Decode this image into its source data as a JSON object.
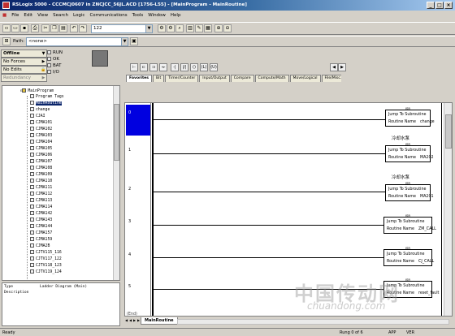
{
  "title": "RSLogix 5000 - CCCMCJ0607 in ZNCJCC_56JL.ACD [1756-L55] - [MainProgram - MainRoutine]",
  "menu": [
    "File",
    "Edit",
    "View",
    "Search",
    "Logic",
    "Communications",
    "Tools",
    "Window",
    "Help"
  ],
  "toolbar": {
    "zoom_value": "122",
    "path_label": "Path:",
    "path_value": "<none>"
  },
  "status_panel": {
    "mode": "Offline",
    "forces": "No Forces",
    "edits": "No Edits",
    "redundancy": "Redundancy",
    "lamps": [
      "RUN",
      "OK",
      "BAT",
      "I/O"
    ]
  },
  "instruction_tabs": [
    "Favorites",
    "Bit",
    "Timer/Counter",
    "Input/Output",
    "Compare",
    "Compute/Math",
    "Move/Logical",
    "File/Misc."
  ],
  "tree": {
    "root": "MainProgram",
    "items": [
      "Program Tags",
      "MainRoutine",
      "change",
      "CJAI",
      "CJMA101",
      "CJMA102",
      "CJMA103",
      "CJMA104",
      "CJMA105",
      "CJMA106",
      "CJMA107",
      "CJMA108",
      "CJMA109",
      "CJMA110",
      "CJMA111",
      "CJMA112",
      "CJMA113",
      "CJMA114",
      "CJMA142",
      "CJMA143",
      "CJMA144",
      "CJMA157",
      "CJMA159",
      "CJMA2B",
      "CJTV115_116",
      "CJTV117_122",
      "CJTV118_123",
      "CJTV119_124"
    ]
  },
  "description": {
    "type_label": "Type",
    "type_value": "Ladder Diagram (Main)",
    "desc_label": "Description"
  },
  "ladder": {
    "rungs": [
      {
        "num": "0",
        "comment": "",
        "routine": "change"
      },
      {
        "num": "1",
        "comment": "冷却水泵",
        "routine": "MA202"
      },
      {
        "num": "2",
        "comment": "冷却水泵",
        "routine": "MA201"
      },
      {
        "num": "3",
        "comment": "",
        "routine": "ZM_CALL"
      },
      {
        "num": "4",
        "comment": "",
        "routine": "CJ_CALL"
      },
      {
        "num": "5",
        "comment": "",
        "routine": "reset_fault"
      }
    ],
    "jsr_header": "JSR",
    "jsr_title": "Jump To Subroutine",
    "jsr_label": "Routine Name",
    "end_label": "(End)",
    "tab": "MainRoutine"
  },
  "statusbar": {
    "ready": "Ready",
    "rung": "Rung 0 of 6",
    "app": "APP",
    "ver": "VER"
  },
  "watermark": {
    "line1": "中国传动网",
    "line2": "chuandong.com"
  }
}
